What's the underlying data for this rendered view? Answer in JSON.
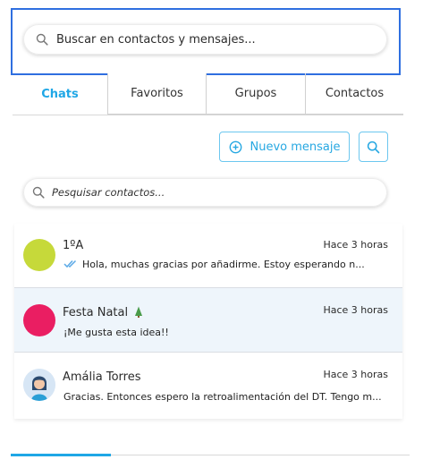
{
  "top_search": {
    "placeholder": "Buscar en contactos y mensajes..."
  },
  "tabs": [
    {
      "label": "Chats",
      "active": true
    },
    {
      "label": "Favoritos",
      "active": false
    },
    {
      "label": "Grupos",
      "active": false
    },
    {
      "label": "Contactos",
      "active": false
    }
  ],
  "actions": {
    "new_message_label": "Nuevo mensaje",
    "search_icon": "search-icon",
    "new_message_icon": "plus-circle-icon"
  },
  "contact_search": {
    "placeholder": "Pesquisar contactos..."
  },
  "chats": [
    {
      "name": "1ºA",
      "time": "Hace 3 horas",
      "preview": "Hola, muchas gracias por añadirme. Estoy esperando n...",
      "status_icon": "double-check-icon",
      "avatar_color": "#c6d93a"
    },
    {
      "name": "Festa Natal",
      "name_icon": "christmas-tree-icon",
      "time": "Hace 3 horas",
      "preview": "¡Me gusta esta idea!!",
      "avatar_color": "#ea1e62",
      "selected": true
    },
    {
      "name": "Amália Torres",
      "time": "Hace 3 horas",
      "preview": "Gracias. Entonces espero la retroalimentación del DT. Tengo m...",
      "avatar_color": "#d7e6f5"
    }
  ],
  "colors": {
    "accent": "#1fa7e6",
    "focus_border": "#2f6fe0"
  }
}
